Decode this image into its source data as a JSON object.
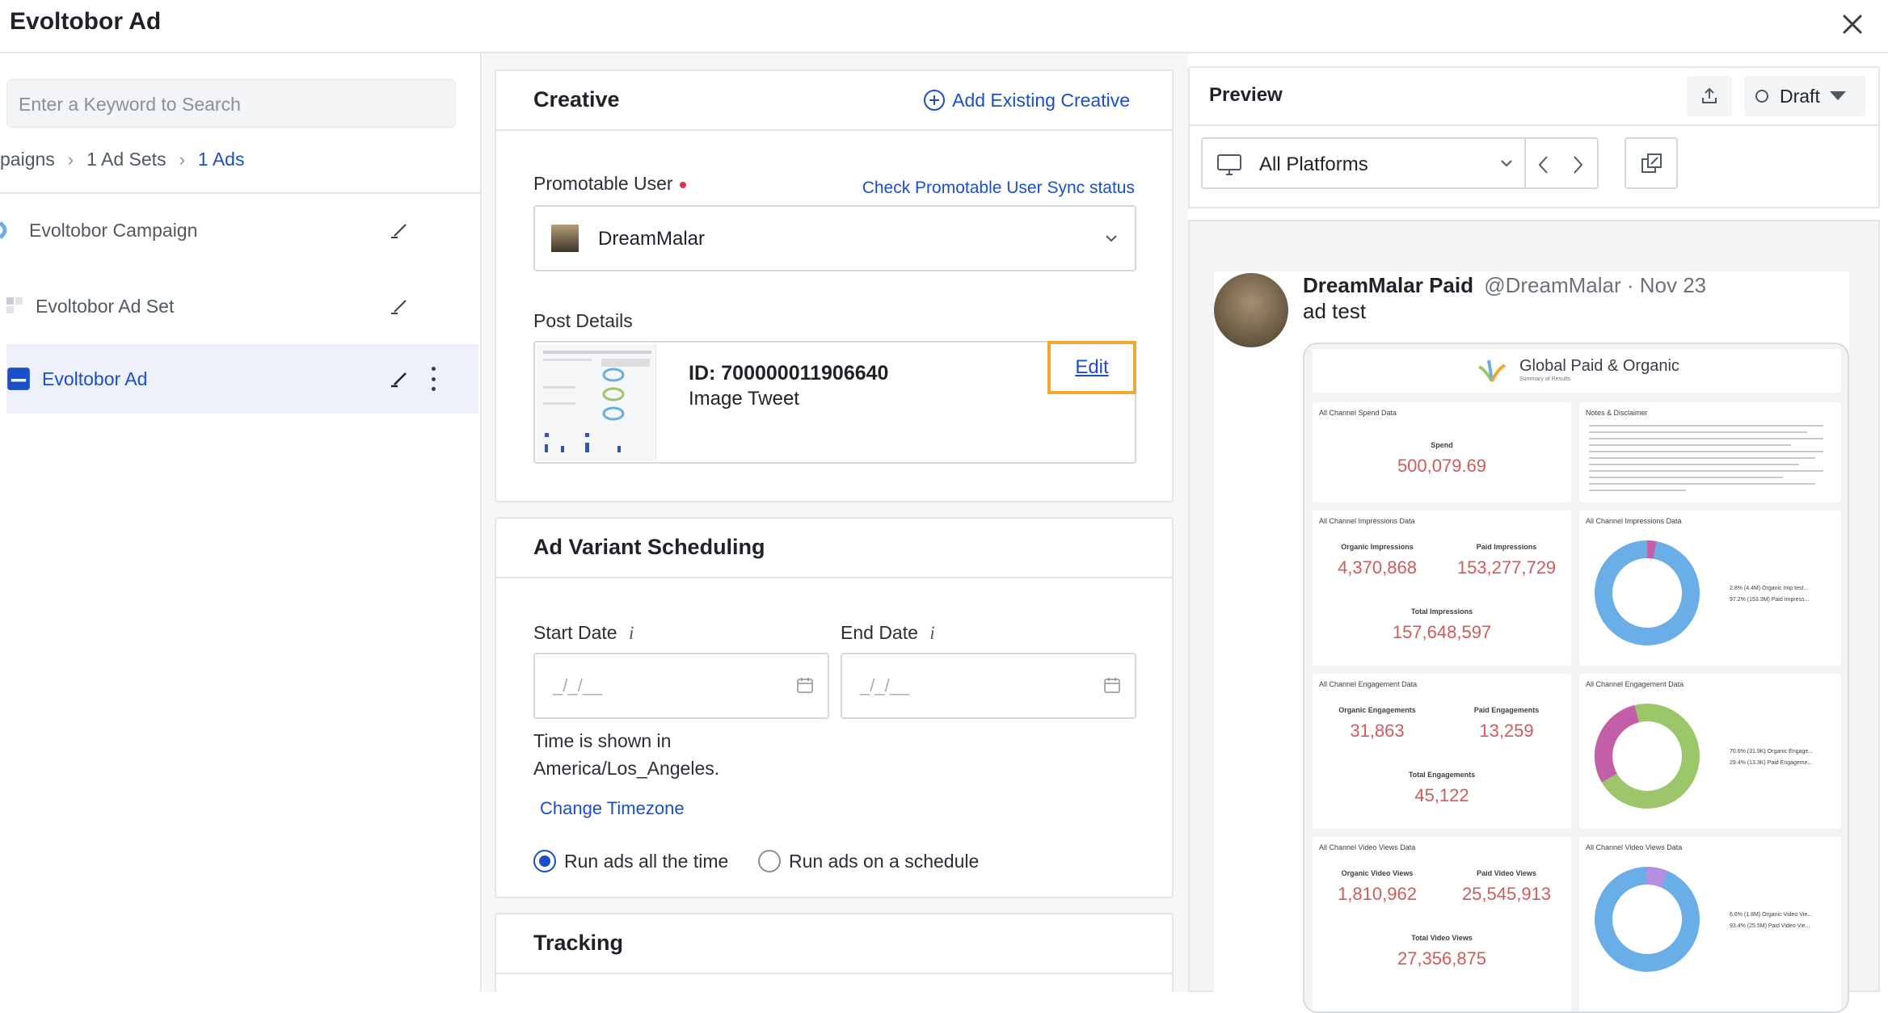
{
  "window": {
    "title": "Evoltobor Ad"
  },
  "left": {
    "search_placeholder": "Enter a Keyword to Search",
    "breadcrumb": [
      "paigns",
      "1 Ad Sets",
      "1 Ads"
    ],
    "items": [
      {
        "label": "Evoltobor Campaign"
      },
      {
        "label": "Evoltobor Ad Set"
      },
      {
        "label": "Evoltobor Ad"
      }
    ]
  },
  "creative": {
    "title": "Creative",
    "add_existing": "Add Existing Creative",
    "promotable_label": "Promotable User",
    "sync_link": "Check Promotable User Sync status",
    "selected_user": "DreamMalar",
    "post_details_label": "Post Details",
    "post_id": "ID: 700000011906640",
    "post_type": "Image Tweet",
    "edit": "Edit"
  },
  "scheduling": {
    "title": "Ad Variant Scheduling",
    "start_label": "Start Date",
    "end_label": "End Date",
    "start_placeholder": "_/_/__",
    "end_placeholder": "_/_/__",
    "tz_line1": "Time is shown in",
    "tz_line2": "America/Los_Angeles.",
    "change_tz": "Change Timezone",
    "radio_all": "Run ads all the time",
    "radio_schedule": "Run ads on a schedule"
  },
  "tracking": {
    "title": "Tracking"
  },
  "preview": {
    "title": "Preview",
    "status": "Draft",
    "platform": "All Platforms",
    "tweet": {
      "name": "DreamMalar Paid",
      "handle": "@DreamMalar · Nov 23",
      "text": "ad test"
    },
    "report": {
      "title": "Global Paid & Organic",
      "subtitle": "Summary of Results",
      "spend_title": "All Channel Spend Data",
      "spend_label": "Spend",
      "spend_value": "500,079.69",
      "notes_title": "Notes & Disclaimer",
      "impr_title": "All Channel Impressions Data",
      "organic_impr_label": "Organic Impressions",
      "organic_impr": "4,370,868",
      "paid_impr_label": "Paid Impressions",
      "paid_impr": "153,277,729",
      "total_impr_label": "Total Impressions",
      "total_impr": "157,648,597",
      "eng_title": "All Channel Engagement Data",
      "organic_eng_label": "Organic Engagements",
      "organic_eng": "31,863",
      "paid_eng_label": "Paid Engagements",
      "paid_eng": "13,259",
      "total_eng_label": "Total Engagements",
      "total_eng": "45,122",
      "vv_title": "All Channel Video Views Data",
      "organic_vv_label": "Organic Video Views",
      "organic_vv": "1,810,962",
      "paid_vv_label": "Paid Video Views",
      "paid_vv": "25,545,913",
      "total_vv_label": "Total Video Views",
      "total_vv": "27,356,875",
      "impr_legend": [
        "2.8% (4.4M) Organic Imp test...",
        "97.2% (153.3M) Paid Impress..."
      ],
      "eng_legend": [
        "70.6% (31.9K) Organic Engage...",
        "29.4% (13.3K) Paid Engageme..."
      ],
      "vv_legend": [
        "6.6% (1.8M) Organic Video Vie...",
        "93.4% (25.5M) Paid Video Vie..."
      ]
    }
  },
  "colors": {
    "accent": "#1a4fc7",
    "highlight": "#f0a830",
    "value_red": "#d25a5a",
    "donut_blue": "#6aaee8",
    "donut_green": "#9cc66a",
    "donut_pink": "#c45ea8"
  }
}
